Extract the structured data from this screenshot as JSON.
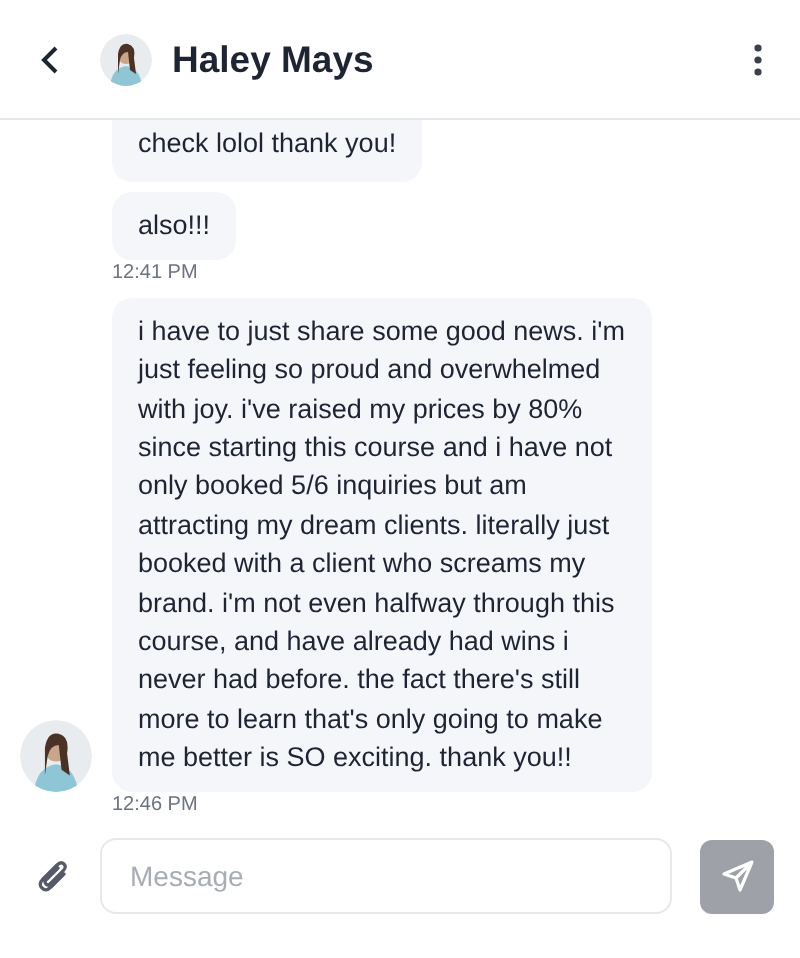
{
  "header": {
    "contact_name": "Haley Mays"
  },
  "messages": [
    {
      "text": "check lolol thank you!",
      "show_avatar": false,
      "cut_top": true
    },
    {
      "text": "also!!!",
      "time": "12:41 PM",
      "show_avatar": false,
      "cut_top": false
    },
    {
      "text": "i have to just share some good news. i'm just feeling so proud and overwhelmed with joy. i've raised my prices by 80% since starting this course and i have not only booked 5/6 inquiries but am attracting my dream clients. literally just booked with a client who screams my brand. i'm not even halfway through this course, and have already had wins i never had before. the fact there's still more to learn that's only going to make me better is SO exciting. thank you!!",
      "time": "12:46 PM",
      "show_avatar": true,
      "cut_top": false
    }
  ],
  "composer": {
    "placeholder": "Message",
    "send_disabled": true
  }
}
